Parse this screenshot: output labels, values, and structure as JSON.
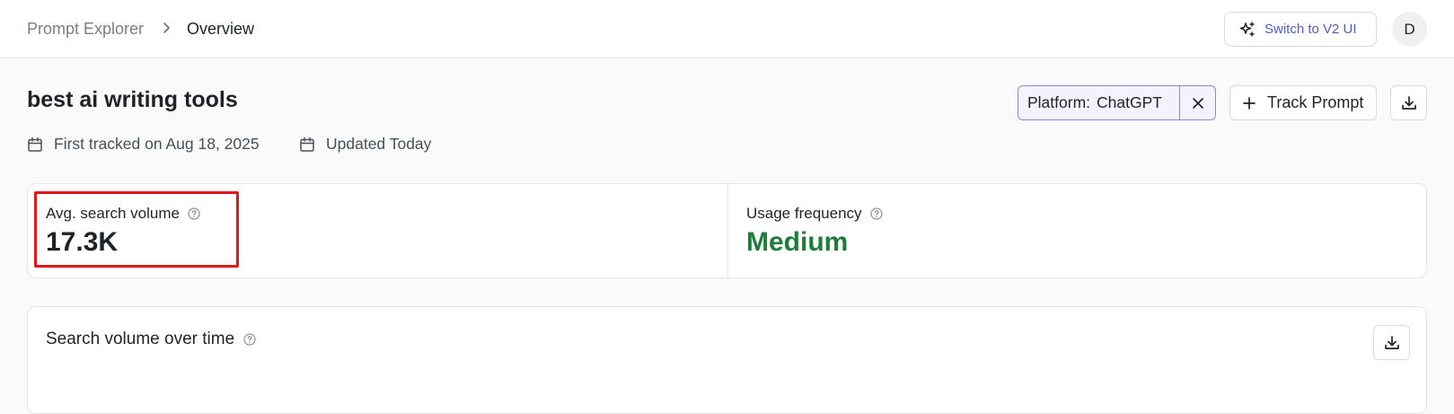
{
  "breadcrumb": {
    "root": "Prompt Explorer",
    "current": "Overview"
  },
  "header": {
    "switch_label": "Switch to V2 UI",
    "avatar_initial": "D"
  },
  "page": {
    "title": "best ai writing tools",
    "first_tracked": "First tracked on Aug 18, 2025",
    "updated": "Updated Today"
  },
  "actions": {
    "platform_label": "Platform:",
    "platform_value": "ChatGPT",
    "track_label": "Track Prompt"
  },
  "metrics": [
    {
      "label": "Avg. search volume",
      "value": "17.3K"
    },
    {
      "label": "Usage frequency",
      "value": "Medium"
    }
  ],
  "chart_section": {
    "title": "Search volume over time"
  },
  "colors": {
    "accent": "#4f5bd5",
    "platform_border": "#8b86d8",
    "medium_green": "#1e7d3a",
    "highlight_red": "#e3161b"
  },
  "icons": {
    "switch": "sparkles-icon",
    "calendar": "calendar-icon",
    "help": "help-circle-icon",
    "close": "close-icon",
    "plus": "plus-icon",
    "download": "download-icon",
    "breadcrumb_sep": "chevron-right-icon"
  }
}
